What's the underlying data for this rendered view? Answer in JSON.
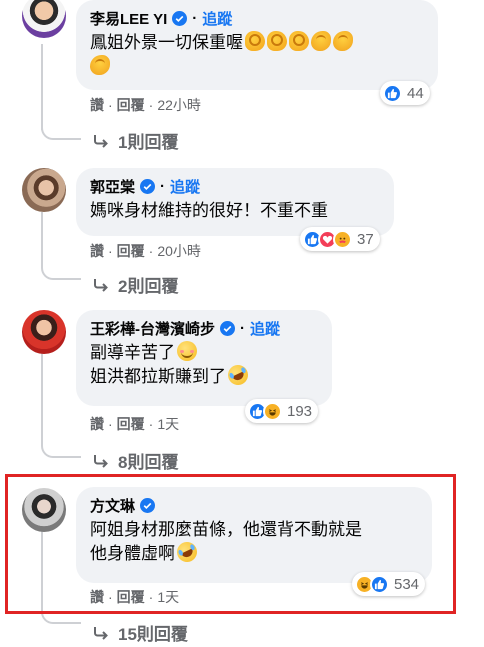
{
  "comments": [
    {
      "name": "李易LEE YI",
      "follow": "追蹤",
      "text_lines": [
        "鳳姐外景一切保重喔"
      ],
      "emoji_line2": "muscle",
      "reaction_count": "44",
      "reactions": [
        "like"
      ],
      "actions": {
        "like": "讚",
        "reply": "回覆",
        "time": "22小時"
      },
      "replies": "1則回覆"
    },
    {
      "name": "郭亞棠",
      "follow": "追蹤",
      "text_lines": [
        "媽咪身材維持的很好！不重不重"
      ],
      "reaction_count": "37",
      "reactions": [
        "like",
        "love",
        "care"
      ],
      "actions": {
        "like": "讚",
        "reply": "回覆",
        "time": "20小時"
      },
      "replies": "2則回覆"
    },
    {
      "name": "王彩樺-台灣濱崎步",
      "follow": "追蹤",
      "text_lines": [
        "副導辛苦了",
        "姐洪都拉斯賺到了"
      ],
      "reaction_count": "193",
      "reactions": [
        "like",
        "haha"
      ],
      "actions": {
        "like": "讚",
        "reply": "回覆",
        "time": "1天"
      },
      "replies": "8則回覆"
    },
    {
      "name": "方文琳",
      "text_lines": [
        "阿姐身材那麼苗條，他還背不動就是",
        "他身體虛啊"
      ],
      "reaction_count": "534",
      "reactions": [
        "haha",
        "like"
      ],
      "actions": {
        "like": "讚",
        "reply": "回覆",
        "time": "1天"
      },
      "replies": "15則回覆"
    }
  ],
  "colors": {
    "accent": "#1877f2",
    "highlight": "#e02424",
    "bubble": "#f0f2f5",
    "meta": "#65676b"
  }
}
